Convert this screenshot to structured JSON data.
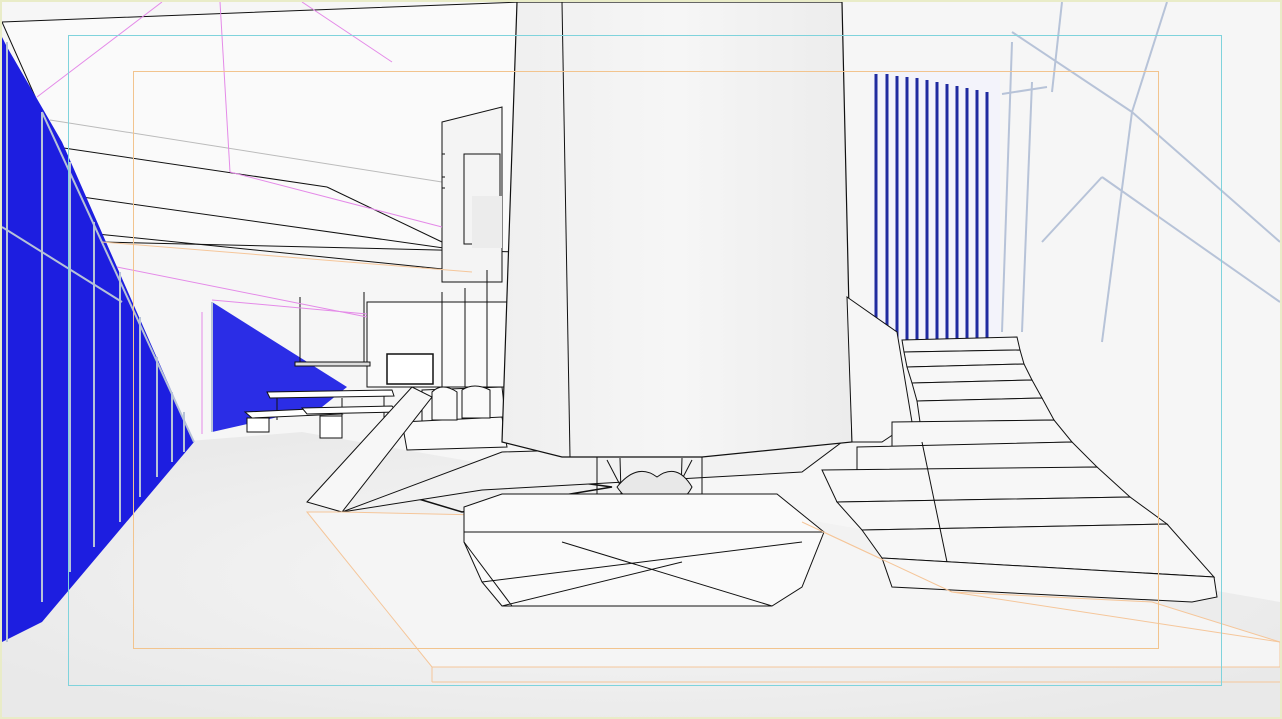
{
  "viewport": {
    "mode": "hidden-line",
    "colors": {
      "background": "#f6f6f6",
      "glass": "#1d1ee0",
      "frame_outer": "#7fd3dc",
      "frame_inner": "#f2c48e",
      "guide_magenta": "#e48ae8",
      "guide_orange": "#f5c69a",
      "edge": "#111111",
      "railing": "#b7c3d8"
    }
  }
}
